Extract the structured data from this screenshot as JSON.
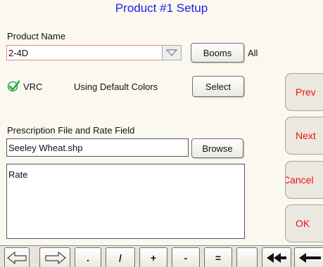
{
  "header": {
    "title": "Product #1 Setup"
  },
  "product": {
    "label": "Product Name",
    "value": "2-4D",
    "booms_button": "Booms",
    "booms_value": "All"
  },
  "vrc": {
    "label": "VRC",
    "colors_text": "Using Default Colors",
    "select_button": "Select",
    "check_color": "#2aa640"
  },
  "prescription": {
    "label": "Prescription File and Rate Field",
    "file_value": "Seeley Wheat.shp",
    "browse_button": "Browse",
    "rate_field": "Rate"
  },
  "side_buttons": {
    "prev": "Prev",
    "next": "Next",
    "cancel": "Cancel",
    "ok": "OK",
    "ok_color": "#ee1111"
  },
  "keyboard": {
    "keys": [
      ".",
      "/",
      "+",
      "-",
      "="
    ]
  }
}
